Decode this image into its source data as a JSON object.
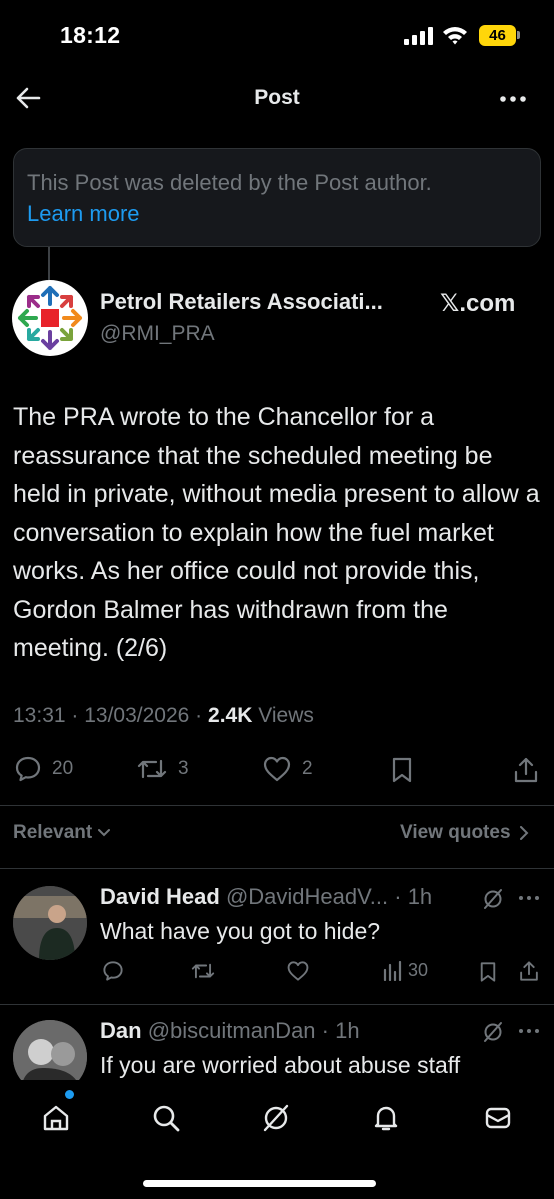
{
  "status_bar": {
    "time": "18:12",
    "battery": "46",
    "battery_color": "#ffd60a"
  },
  "header": {
    "title": "Post",
    "back_icon": "arrow-left-icon",
    "more_icon": "more-horizontal-icon"
  },
  "deleted_notice": {
    "text": "This Post was deleted by the Post author.",
    "link": "Learn more"
  },
  "post": {
    "author_name": "Petrol Retailers Associati...",
    "author_handle": "@RMI_PRA",
    "badge_label": "𝕏.com",
    "body": "The PRA wrote to the Chancellor for a reassurance that the scheduled meeting be held in private, without media present to allow a conversation to explain how the fuel market works. As her office could not provide this, Gordon Balmer has withdrawn from the meeting. (2/6)",
    "time": "13:31",
    "date": "13/03/2026",
    "views_count": "2.4K",
    "views_label": "Views",
    "replies": "20",
    "reposts": "3",
    "likes": "2"
  },
  "sort": {
    "relevant_label": "Relevant",
    "view_quotes_label": "View quotes"
  },
  "replies": [
    {
      "name": "David Head",
      "handle": "@DavidHeadV...",
      "age": "1h",
      "text": "What have you got to hide?",
      "views": "30"
    },
    {
      "name": "Dan",
      "handle": "@biscuitmanDan",
      "age": "1h",
      "text": "If you are worried about abuse staff"
    }
  ],
  "tab_bar": {
    "tabs": [
      "home-icon",
      "search-icon",
      "grok-icon",
      "notifications-icon",
      "messages-icon"
    ],
    "accent": "#1d9bf0"
  }
}
